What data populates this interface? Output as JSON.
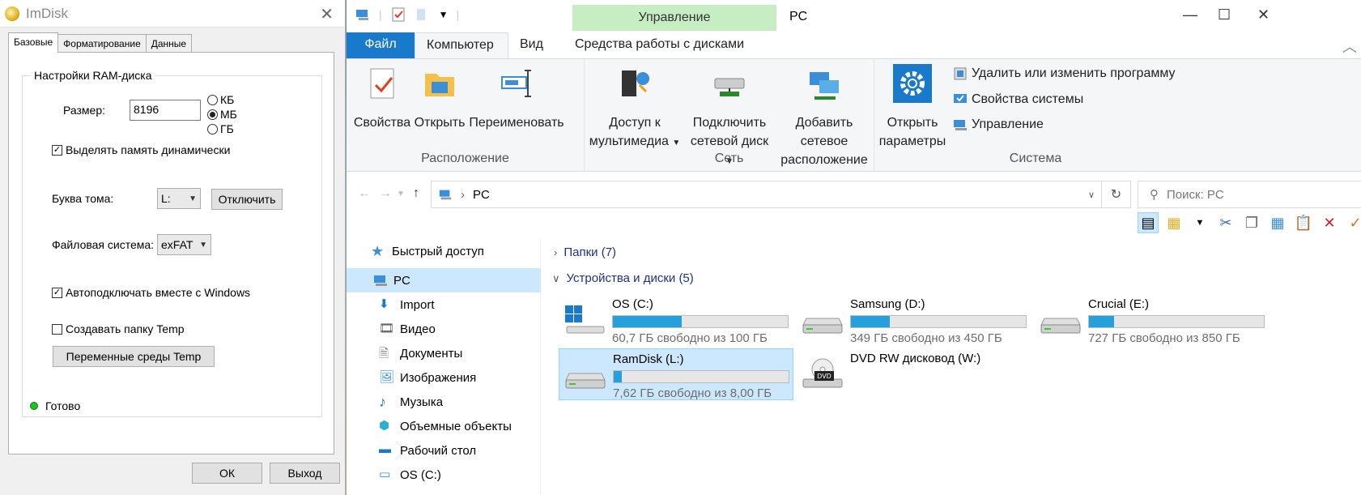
{
  "imdisk": {
    "title": "ImDisk",
    "tabs": [
      "Базовые",
      "Форматирование",
      "Данные"
    ],
    "group_title": "Настройки RAM-диска",
    "size_label": "Размер:",
    "size_value": "8196",
    "units": [
      "КБ",
      "МБ",
      "ГБ"
    ],
    "selected_unit": "МБ",
    "dynamic_alloc": "Выделять память динамически",
    "drive_letter_label": "Буква тома:",
    "drive_letter_value": "L:",
    "disconnect_button": "Отключить",
    "fs_label": "Файловая система:",
    "fs_value": "exFAT",
    "autoconnect": "Автоподключать вместе с Windows",
    "create_temp": "Создавать папку Temp",
    "env_button": "Переменные среды Temp",
    "status": "Готово",
    "ok_button": "ОК",
    "exit_button": "Выход"
  },
  "explorer": {
    "contextual_tab": "Управление",
    "window_title": "PC",
    "ribbon_tabs": [
      "Файл",
      "Компьютер",
      "Вид",
      "Средства работы с дисками"
    ],
    "groups": {
      "location": {
        "label": "Расположение",
        "buttons": [
          "Свойства",
          "Открыть",
          "Переименовать"
        ]
      },
      "network": {
        "label": "Сеть",
        "media_line1": "Доступ к",
        "media_line2": "мультимедиа",
        "map_line1": "Подключить",
        "map_line2": "сетевой диск",
        "addnet_line1": "Добавить сетевое",
        "addnet_line2": "расположение"
      },
      "system": {
        "label": "Система",
        "open_line1": "Открыть",
        "open_line2": "параметры",
        "small": [
          "Удалить или изменить программу",
          "Свойства системы",
          "Управление"
        ]
      }
    },
    "address": "PC",
    "search_placeholder": "Поиск: PC",
    "nav": {
      "quick_access": "Быстрый доступ",
      "items": [
        "PC",
        "Import",
        "Видео",
        "Документы",
        "Изображения",
        "Музыка",
        "Объемные объекты",
        "Рабочий стол",
        "OS (C:)"
      ]
    },
    "sections": {
      "folders": "Папки (7)",
      "devices": "Устройства и диски (5)"
    },
    "drives": [
      {
        "name": "OS (C:)",
        "free": "60,7 ГБ свободно из 100 ГБ",
        "used_fraction": 0.393
      },
      {
        "name": "Samsung (D:)",
        "free": "349 ГБ свободно из 450 ГБ",
        "used_fraction": 0.224
      },
      {
        "name": "Crucial (E:)",
        "free": "727 ГБ свободно из 850 ГБ",
        "used_fraction": 0.145
      },
      {
        "name": "RamDisk (L:)",
        "free": "7,62 ГБ свободно из 8,00 ГБ",
        "used_fraction": 0.048
      },
      {
        "name": "DVD RW дисковод (W:)",
        "free": "",
        "used_fraction": null
      }
    ],
    "colors": {
      "accent": "#1979ca",
      "bar_fill": "#26a0da",
      "selection": "#cce8ff",
      "manage_tab": "#c6eec2"
    }
  }
}
